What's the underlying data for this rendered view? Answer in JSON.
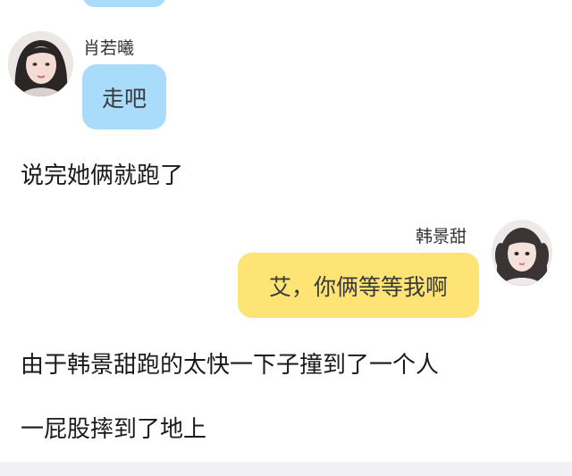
{
  "chat": {
    "messages": [
      {
        "sender": "肖若曦",
        "text": "走吧",
        "side": "left",
        "bubble_color": "#a8dcfa"
      },
      {
        "sender": "韩景甜",
        "text": "艾，你俩等等我啊",
        "side": "right",
        "bubble_color": "#fde474"
      }
    ]
  },
  "narration": [
    "说完她俩就跑了",
    "由于韩景甜跑的太快一下子撞到了一个人",
    "一屁股摔到了地上"
  ]
}
